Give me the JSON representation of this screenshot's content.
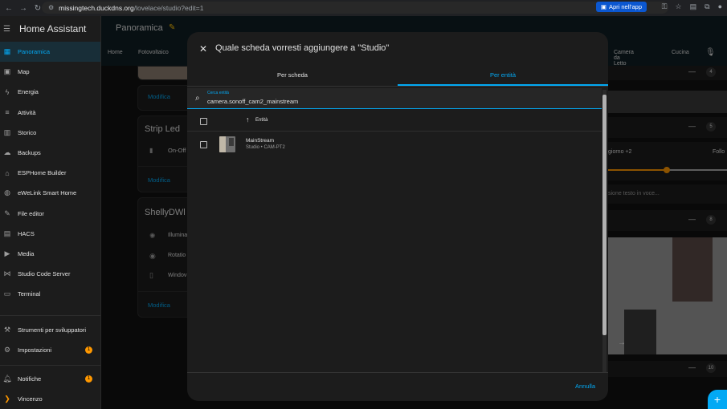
{
  "browser": {
    "url_host": "missingtech.duckdns.org",
    "url_path": "/lovelace/studio?edit=1",
    "app_button": "Apri nell'app"
  },
  "sidebar": {
    "title": "Home Assistant",
    "items": [
      {
        "label": "Panoramica",
        "icon": "grid-icon"
      },
      {
        "label": "Map",
        "icon": "map-icon"
      },
      {
        "label": "Energia",
        "icon": "lightning-icon"
      },
      {
        "label": "Attività",
        "icon": "list-icon"
      },
      {
        "label": "Storico",
        "icon": "chart-icon"
      },
      {
        "label": "Backups",
        "icon": "cloud-icon"
      },
      {
        "label": "ESPHome Builder",
        "icon": "esphome-icon"
      },
      {
        "label": "eWeLink Smart Home",
        "icon": "globe-icon"
      },
      {
        "label": "File editor",
        "icon": "wrench-icon"
      },
      {
        "label": "HACS",
        "icon": "hacs-icon"
      },
      {
        "label": "Media",
        "icon": "media-icon"
      },
      {
        "label": "Studio Code Server",
        "icon": "code-icon"
      },
      {
        "label": "Terminal",
        "icon": "terminal-icon"
      }
    ],
    "bottom_items": [
      {
        "label": "Strumenti per sviluppatori",
        "icon": "hammer-icon"
      },
      {
        "label": "Impostazioni",
        "icon": "gear-icon",
        "badge": "1"
      },
      {
        "label": "Notifiche",
        "icon": "bell-icon",
        "badge": "1"
      },
      {
        "label": "Vincenzo",
        "icon": "avatar-icon"
      }
    ]
  },
  "topbar": {
    "title": "Panoramica",
    "tabs": [
      "Home",
      "Fotovoltaico",
      "Camera da Letto",
      "Cucina"
    ]
  },
  "background": {
    "modifica": "Modifica",
    "strip_led": "Strip Led",
    "on_off": "On-Off",
    "shelly": "ShellyDWl",
    "shelly_rows": [
      "Illumina",
      "Rotatio",
      "Windov"
    ],
    "right_counts": [
      "4",
      "5",
      "8",
      "10"
    ],
    "slider_left": "giorno +2",
    "slider_right": "Follo",
    "text_placeholder": "sione testo in voce..."
  },
  "dialog": {
    "title": "Quale scheda vorresti aggiungere a \"Studio\"",
    "tabs": [
      "Per scheda",
      "Per entità"
    ],
    "active_tab": 1,
    "search_label": "Cerca entità",
    "search_value": "camera.sonoff_cam2_mainstream",
    "column_header": "Entità",
    "rows": [
      {
        "name": "MainStream",
        "sub": "Studio • CAM-PT2"
      }
    ],
    "cancel": "Annulla"
  },
  "colors": {
    "accent": "#03a9f4",
    "badge": "#ff9800",
    "edit_icon": "#ffc107"
  }
}
